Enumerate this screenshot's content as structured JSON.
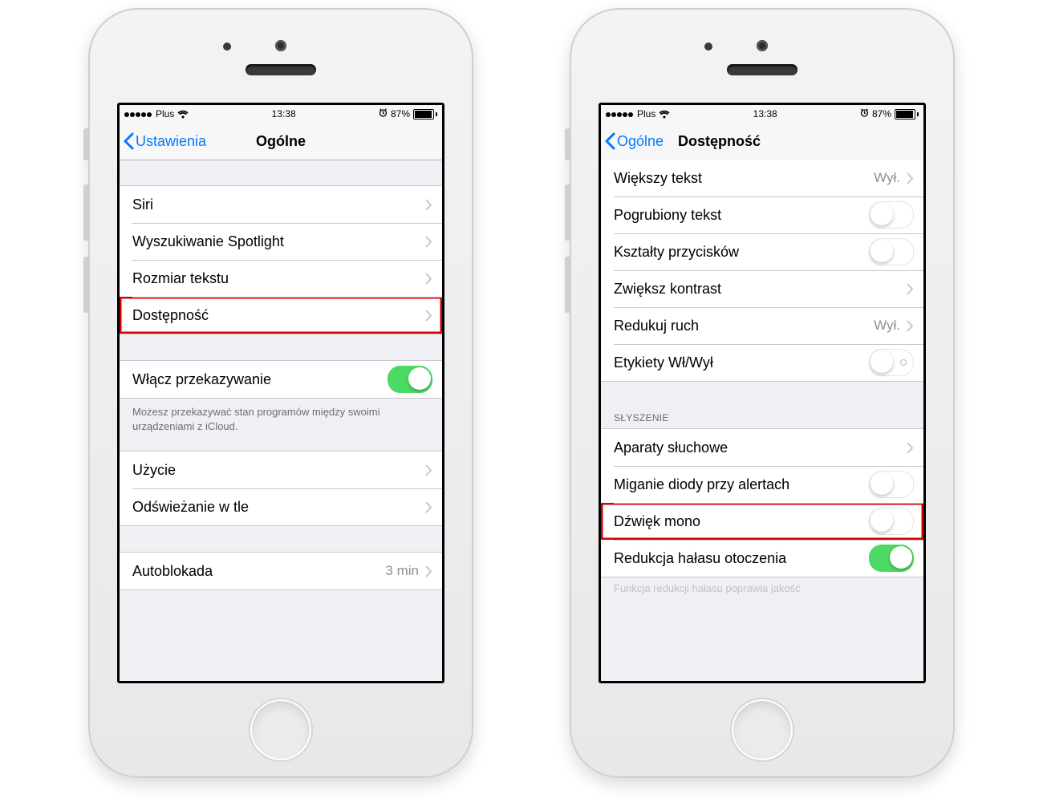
{
  "status": {
    "carrier": "Plus",
    "time": "13:38",
    "battery_pct": "87%"
  },
  "left": {
    "back": "Ustawienia",
    "title": "Ogólne",
    "group1": {
      "siri": "Siri",
      "spotlight": "Wyszukiwanie Spotlight",
      "textsize": "Rozmiar tekstu",
      "accessibility": "Dostępność"
    },
    "group2": {
      "handoff": "Włącz przekazywanie",
      "footer": "Możesz przekazywać stan programów między swoimi urządzeniami z iCloud."
    },
    "group3": {
      "usage": "Użycie",
      "bgrefresh": "Odświeżanie w tle"
    },
    "group4": {
      "autolock": "Autoblokada",
      "autolock_value": "3 min"
    }
  },
  "right": {
    "back": "Ogólne",
    "title": "Dostępność",
    "group1": {
      "larger": "Większy tekst",
      "larger_value": "Wył.",
      "bold": "Pogrubiony tekst",
      "shapes": "Kształty przycisków",
      "contrast": "Zwiększ kontrast",
      "reduce": "Redukuj ruch",
      "reduce_value": "Wył.",
      "labels": "Etykiety Wł/Wył"
    },
    "hearing_header": "SŁYSZENIE",
    "group2": {
      "aids": "Aparaty słuchowe",
      "led": "Miganie diody przy alertach",
      "mono": "Dźwięk mono",
      "noise": "Redukcja hałasu otoczenia"
    },
    "cutoff": "Funkcja redukcji hałasu poprawia jakość"
  }
}
